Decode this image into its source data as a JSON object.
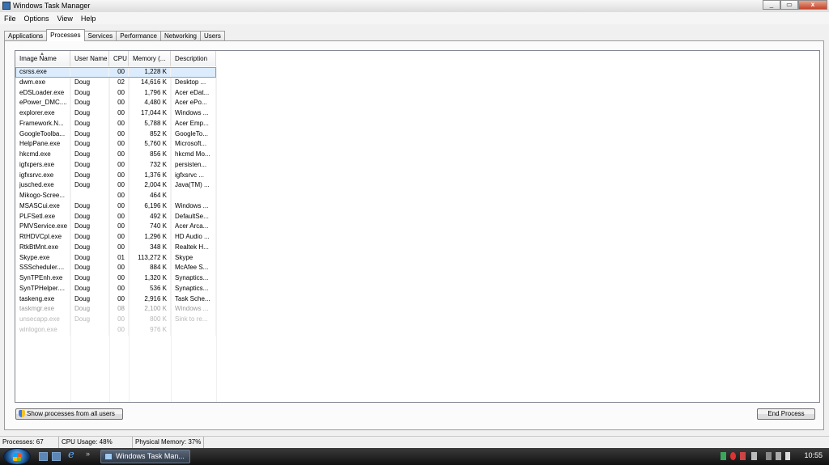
{
  "window": {
    "title": "Windows Task Manager"
  },
  "menu": [
    "File",
    "Options",
    "View",
    "Help"
  ],
  "tabs": [
    {
      "label": "Applications"
    },
    {
      "label": "Processes",
      "active": true
    },
    {
      "label": "Services"
    },
    {
      "label": "Performance"
    },
    {
      "label": "Networking"
    },
    {
      "label": "Users"
    }
  ],
  "columns": [
    "Image Name",
    "User Name",
    "CPU",
    "Memory (...",
    "Description"
  ],
  "processes": [
    [
      "csrss.exe",
      "",
      "00",
      "1,228 K",
      ""
    ],
    [
      "dwm.exe",
      "Doug",
      "02",
      "14,616 K",
      "Desktop ..."
    ],
    [
      "eDSLoader.exe",
      "Doug",
      "00",
      "1,796 K",
      "Acer eDat..."
    ],
    [
      "ePower_DMC....",
      "Doug",
      "00",
      "4,480 K",
      "Acer ePo..."
    ],
    [
      "explorer.exe",
      "Doug",
      "00",
      "17,044 K",
      "Windows ..."
    ],
    [
      "Framework.N...",
      "Doug",
      "00",
      "5,788 K",
      "Acer Emp..."
    ],
    [
      "GoogleToolba...",
      "Doug",
      "00",
      "852 K",
      "GoogleTo..."
    ],
    [
      "HelpPane.exe",
      "Doug",
      "00",
      "5,760 K",
      "Microsoft..."
    ],
    [
      "hkcmd.exe",
      "Doug",
      "00",
      "856 K",
      "hkcmd Mo..."
    ],
    [
      "igfxpers.exe",
      "Doug",
      "00",
      "732 K",
      "persisten..."
    ],
    [
      "igfxsrvc.exe",
      "Doug",
      "00",
      "1,376 K",
      "igfxsrvc ..."
    ],
    [
      "jusched.exe",
      "Doug",
      "00",
      "2,004 K",
      "Java(TM) ..."
    ],
    [
      "Mikogo-Scree...",
      "",
      "00",
      "464 K",
      ""
    ],
    [
      "MSASCui.exe",
      "Doug",
      "00",
      "6,196 K",
      "Windows ..."
    ],
    [
      "PLFSetI.exe",
      "Doug",
      "00",
      "492 K",
      "DefaultSe..."
    ],
    [
      "PMVService.exe",
      "Doug",
      "00",
      "740 K",
      "Acer Arca..."
    ],
    [
      "RtHDVCpl.exe",
      "Doug",
      "00",
      "1,296 K",
      "HD Audio ..."
    ],
    [
      "RtkBtMnt.exe",
      "Doug",
      "00",
      "348 K",
      "Realtek H..."
    ],
    [
      "Skype.exe",
      "Doug",
      "01",
      "113,272 K",
      "Skype"
    ],
    [
      "SSScheduler....",
      "Doug",
      "00",
      "884 K",
      "McAfee S..."
    ],
    [
      "SynTPEnh.exe",
      "Doug",
      "00",
      "1,320 K",
      "Synaptics..."
    ],
    [
      "SynTPHelper....",
      "Doug",
      "00",
      "536 K",
      "Synaptics..."
    ],
    [
      "taskeng.exe",
      "Doug",
      "00",
      "2,916 K",
      "Task Sche..."
    ],
    [
      "taskmgr.exe",
      "Doug",
      "08",
      "2,100 K",
      "Windows ..."
    ],
    [
      "unsecapp.exe",
      "Doug",
      "00",
      "800 K",
      "Sink to re..."
    ],
    [
      "winlogon.exe",
      "",
      "00",
      "976 K",
      ""
    ]
  ],
  "buttons": {
    "show_all": "Show processes from all users",
    "end_process": "End Process"
  },
  "status": {
    "processes": "Processes: 67",
    "cpu": "CPU Usage: 48%",
    "memory": "Physical Memory: 37%"
  },
  "taskbar": {
    "window_button": "Windows Task Man...",
    "clock": "10:55"
  },
  "colors": {
    "selection": "#dcecfc",
    "taskbar": "#1b1b1b"
  },
  "icons": [
    "app-icon",
    "shield-icon",
    "start-orb-icon",
    "ie-icon",
    "tray-icon"
  ]
}
